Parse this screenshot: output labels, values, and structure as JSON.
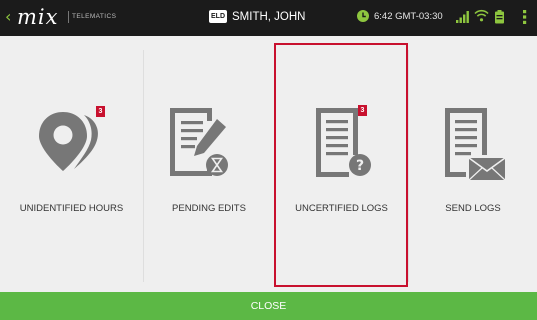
{
  "header": {
    "brand": "mix",
    "brand_sub": "TELEMATICS",
    "eld_badge": "ELD",
    "driver_name": "SMITH, JOHN",
    "time": "6:42 GMT-03:30"
  },
  "tiles": [
    {
      "label": "UNIDENTIFIED HOURS",
      "badge": "3",
      "icon": "location-pin-icon"
    },
    {
      "label": "PENDING EDITS",
      "badge": "",
      "icon": "document-edit-icon"
    },
    {
      "label": "UNCERTIFIED LOGS",
      "badge": "3",
      "icon": "document-question-icon"
    },
    {
      "label": "SEND LOGS",
      "badge": "",
      "icon": "document-mail-icon"
    }
  ],
  "footer": {
    "close_label": "CLOSE"
  },
  "colors": {
    "topbar": "#1b1b1b",
    "accent_green": "#5cb845",
    "badge_red": "#c8102e",
    "icon_gray": "#777777",
    "background": "#efefef"
  }
}
